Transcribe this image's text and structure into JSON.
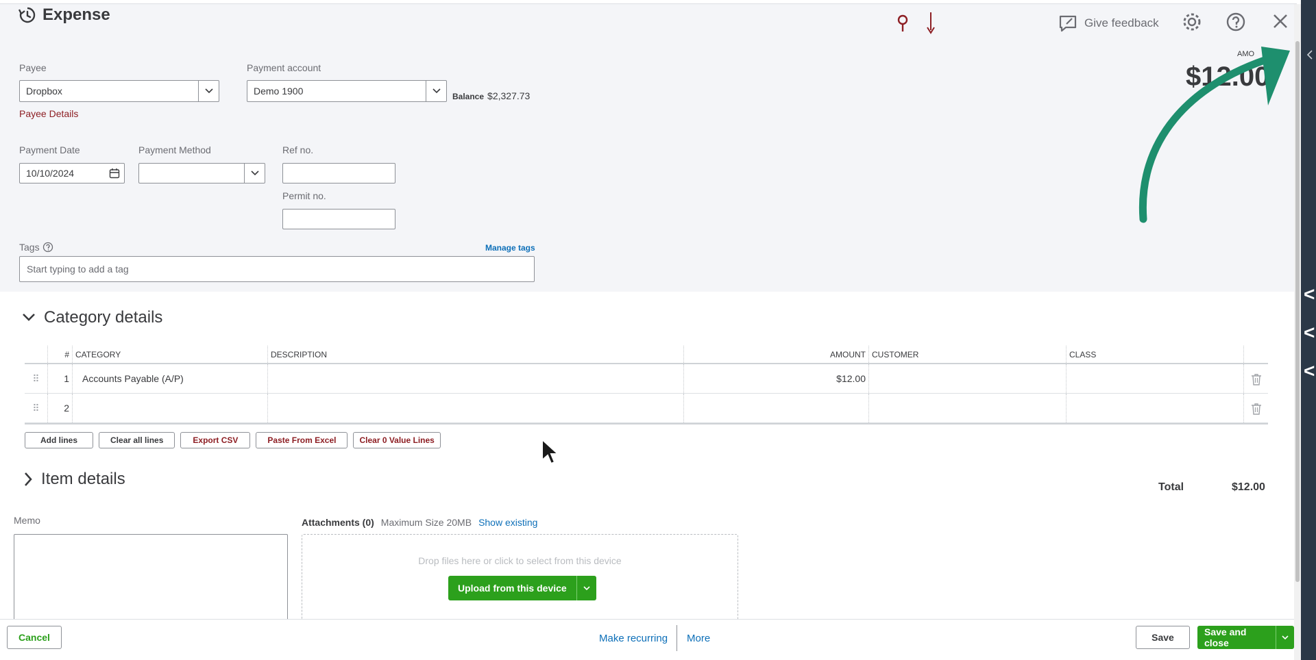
{
  "header": {
    "title": "Expense",
    "feedback_label": "Give feedback"
  },
  "amount": {
    "label": "AMO",
    "value": "$12.00"
  },
  "payee": {
    "label": "Payee",
    "value": "Dropbox",
    "details_link": "Payee Details"
  },
  "payment_account": {
    "label": "Payment account",
    "value": "Demo 1900",
    "balance_label": "Balance",
    "balance_value": "$2,327.73"
  },
  "payment_date": {
    "label": "Payment Date",
    "value": "10/10/2024"
  },
  "payment_method": {
    "label": "Payment Method",
    "value": ""
  },
  "ref_no": {
    "label": "Ref no.",
    "value": ""
  },
  "permit_no": {
    "label": "Permit no.",
    "value": ""
  },
  "tags": {
    "label": "Tags",
    "manage_label": "Manage tags",
    "placeholder": "Start typing to add a tag"
  },
  "category_details": {
    "title": "Category details",
    "columns": {
      "num": "#",
      "category": "CATEGORY",
      "description": "DESCRIPTION",
      "amount": "AMOUNT",
      "customer": "CUSTOMER",
      "class": "CLASS"
    },
    "rows": [
      {
        "num": "1",
        "category": "Accounts Payable (A/P)",
        "description": "",
        "amount": "$12.00",
        "customer": "",
        "class": ""
      },
      {
        "num": "2",
        "category": "",
        "description": "",
        "amount": "",
        "customer": "",
        "class": ""
      }
    ],
    "buttons": {
      "add_lines": "Add lines",
      "clear_all": "Clear all lines",
      "export_csv": "Export CSV",
      "paste_excel": "Paste From Excel",
      "clear_zero": "Clear 0 Value Lines"
    }
  },
  "item_details": {
    "title": "Item details"
  },
  "total": {
    "label": "Total",
    "value": "$12.00"
  },
  "memo": {
    "label": "Memo"
  },
  "attachments": {
    "label": "Attachments (0)",
    "max_size": "Maximum Size 20MB",
    "show_existing": "Show existing",
    "drop_text": "Drop files here or click to select from this device",
    "upload_label": "Upload from this device"
  },
  "footer": {
    "cancel": "Cancel",
    "make_recurring": "Make recurring",
    "more": "More",
    "save": "Save",
    "save_and_close": "Save and close"
  },
  "colors": {
    "brand_green": "#2ca01c",
    "link_blue": "#0d6fb8",
    "accent_red": "#8d1e23",
    "annotation_teal": "#1e8f6e"
  },
  "icons": [
    "history-icon",
    "pin-icon",
    "thermometer-icon",
    "feedback-icon",
    "gear-icon",
    "help-icon",
    "close-icon",
    "chevron-down-icon",
    "calendar-icon",
    "drag-handle-icon",
    "trash-icon"
  ]
}
